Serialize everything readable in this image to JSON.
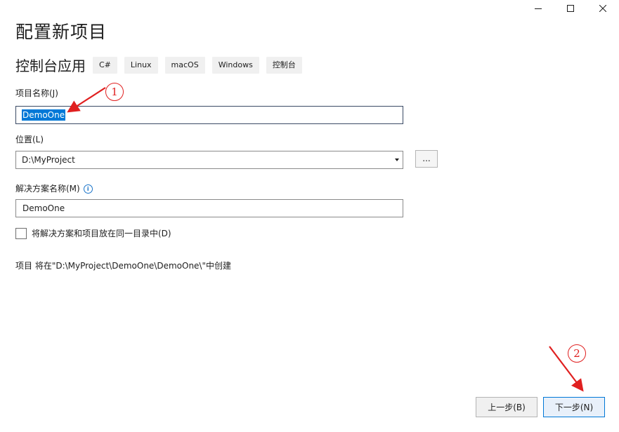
{
  "window": {
    "controls": [
      "minimize-icon",
      "maximize-icon",
      "close-icon"
    ]
  },
  "page": {
    "title": "配置新项目"
  },
  "template": {
    "name": "控制台应用",
    "tags": [
      "C#",
      "Linux",
      "macOS",
      "Windows",
      "控制台"
    ]
  },
  "project_name": {
    "label": "项目名称(J)",
    "value": "DemoOne"
  },
  "location": {
    "label": "位置(L)",
    "value": "D:\\MyProject",
    "browse_label": "..."
  },
  "solution_name": {
    "label": "解决方案名称(M)",
    "value": "DemoOne"
  },
  "same_dir_checkbox": {
    "label": "将解决方案和项目放在同一目录中(D)",
    "checked": false
  },
  "summary": "项目 将在\"D:\\MyProject\\DemoOne\\DemoOne\\\"中创建",
  "footer": {
    "back_label": "上一步(B)",
    "next_label": "下一步(N)"
  },
  "annotations": {
    "marker_1": "1",
    "marker_2": "2",
    "color": "#e02020"
  },
  "colors": {
    "selection": "#0078d7",
    "primary_border": "#0078d7",
    "info_icon": "#1a74c9"
  }
}
